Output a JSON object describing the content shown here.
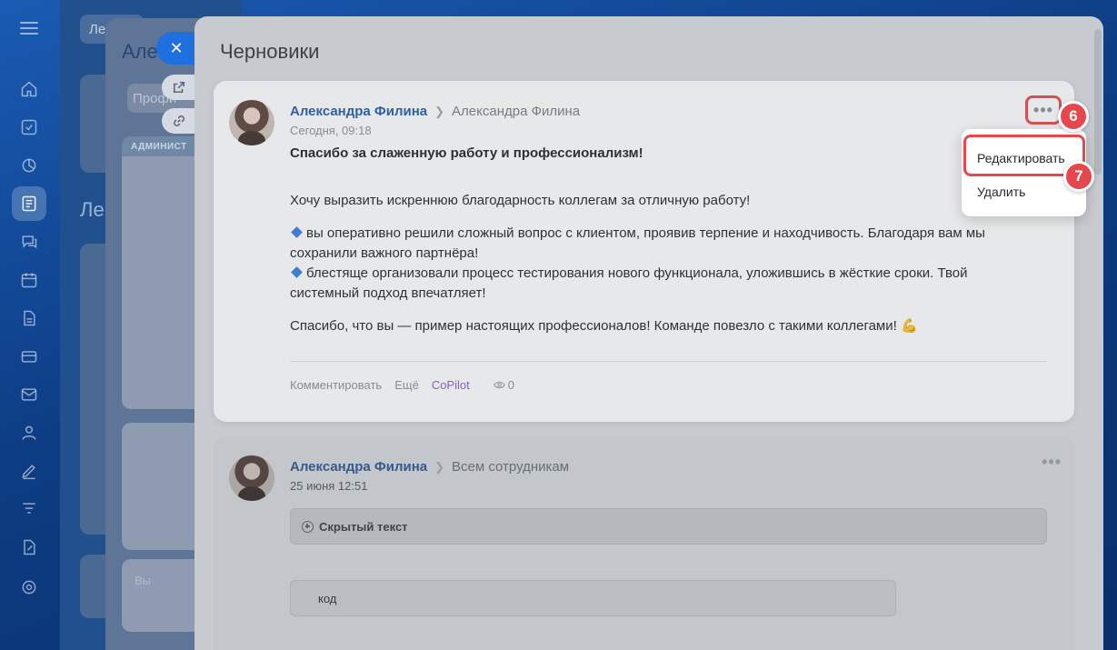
{
  "background": {
    "layer1": {
      "chip_label": "Ле",
      "heading": "Ле"
    },
    "layer2": {
      "title": "Але",
      "tab_label": "Профи",
      "panel_strip": "АДМИНИСТ",
      "panel3_text": "Вы"
    }
  },
  "drafts": {
    "title": "Черновики",
    "posts": [
      {
        "author": "Александра Филина",
        "target": "Александра Филина",
        "date": "Сегодня, 09:18",
        "headline": "Спасибо за слаженную работу и профессионализм!",
        "intro": "Хочу выразить искреннюю благодарность коллегам за отличную работу!",
        "point1": "вы оперативно решили сложный вопрос с клиентом, проявив терпение и находчивость. Благодаря вам мы сохранили важного партнёра!",
        "point2": "блестяще организовали процесс тестирования нового функционала, уложившись в жёсткие сроки. Твой системный подход впечатляет!",
        "closing": "Спасибо, что вы — пример настоящих профессионалов! Команде повезло с такими коллегами! 💪",
        "actions": {
          "comment": "Комментировать",
          "more": "Ещё",
          "copilot": "CoPilot",
          "views": "0"
        }
      },
      {
        "author": "Александра Филина",
        "target": "Всем сотрудникам",
        "date": "25 июня 12:51",
        "hidden_text_label": "Скрытый текст",
        "code_label": "код"
      }
    ]
  },
  "menu": {
    "edit": "Редактировать",
    "delete": "Удалить"
  },
  "badges": {
    "step6": "6",
    "step7": "7"
  },
  "colors": {
    "accent": "#1f5aa6",
    "highlight": "#e6474d",
    "copilot": "#8b5bd6"
  }
}
